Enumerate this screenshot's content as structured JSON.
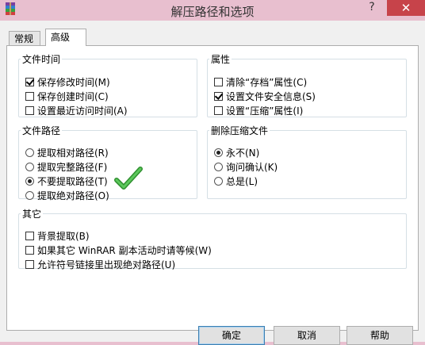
{
  "window": {
    "title": "解压路径和选项",
    "help_glyph": "?",
    "close_glyph": "✕",
    "app_icon": "winrar-archive-icon"
  },
  "tabs": [
    {
      "label": "常规",
      "selected": false
    },
    {
      "label": "高级",
      "selected": true
    }
  ],
  "groups": {
    "file_time": {
      "label": "文件时间",
      "options": [
        {
          "label": "保存修改时间(M)",
          "checked": true
        },
        {
          "label": "保存创建时间(C)",
          "checked": false
        },
        {
          "label": "设置最近访问时间(A)",
          "checked": false
        }
      ]
    },
    "attributes": {
      "label": "属性",
      "options": [
        {
          "label": "清除“存档”属性(C)",
          "checked": false
        },
        {
          "label": "设置文件安全信息(S)",
          "checked": true
        },
        {
          "label": "设置“压缩”属性(I)",
          "checked": false
        }
      ]
    },
    "file_path": {
      "label": "文件路径",
      "options": [
        {
          "label": "提取相对路径(R)",
          "checked": false
        },
        {
          "label": "提取完整路径(F)",
          "checked": false
        },
        {
          "label": "不要提取路径(T)",
          "checked": true
        },
        {
          "label": "提取绝对路径(O)",
          "checked": false
        }
      ]
    },
    "delete_archive": {
      "label": "删除压缩文件",
      "options": [
        {
          "label": "永不(N)",
          "checked": true
        },
        {
          "label": "询问确认(K)",
          "checked": false
        },
        {
          "label": "总是(L)",
          "checked": false
        }
      ]
    },
    "misc": {
      "label": "其它",
      "options": [
        {
          "label": "背景提取(B)",
          "checked": false
        },
        {
          "label": "如果其它 WinRAR 副本活动时请等候(W)",
          "checked": false
        },
        {
          "label": "允许符号链接里出现绝对路径(U)",
          "checked": false
        }
      ]
    }
  },
  "annotation": {
    "icon": "green-checkmark-icon",
    "color": "#3aa83a"
  },
  "buttons": {
    "ok": "确定",
    "cancel": "取消",
    "help": "帮助"
  },
  "colors": {
    "titlebar": "#e8bfcf",
    "close_button": "#c7434a",
    "dialog_bg": "#f0f0f0"
  }
}
